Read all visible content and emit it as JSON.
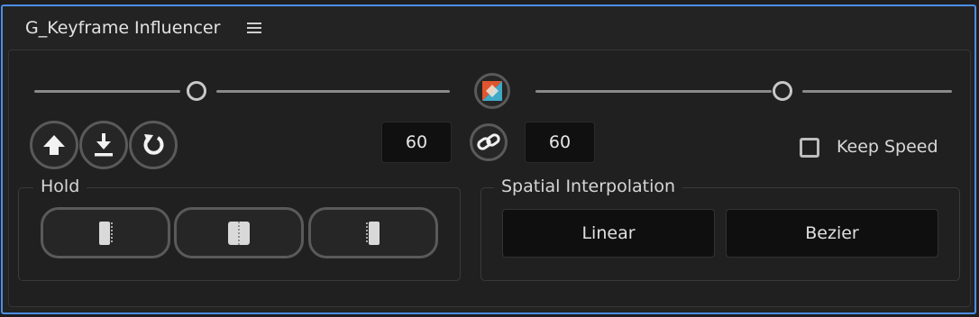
{
  "panel": {
    "title": "G_Keyframe Influencer",
    "menu_icon": "hamburger-menu-icon"
  },
  "sliders": {
    "left": {
      "value_fraction": 0.5
    },
    "right": {
      "value_fraction": 0.59
    },
    "center_icon": "keyframe-influence-icon"
  },
  "actions": {
    "icons": [
      "upload-arrow-icon",
      "download-icon",
      "reset-icon"
    ]
  },
  "influence": {
    "in_value": "60",
    "out_value": "60",
    "link_icon": "chain-link-icon"
  },
  "keep_speed": {
    "label": "Keep Speed",
    "checked": false
  },
  "hold": {
    "label": "Hold",
    "buttons": [
      "hold-in-icon",
      "hold-both-icon",
      "hold-out-icon"
    ]
  },
  "spatial": {
    "label": "Spatial Interpolation",
    "linear_label": "Linear",
    "bezier_label": "Bezier"
  },
  "colors": {
    "accent_border": "#4c8fe8",
    "background": "#232323",
    "field": "#101010"
  }
}
